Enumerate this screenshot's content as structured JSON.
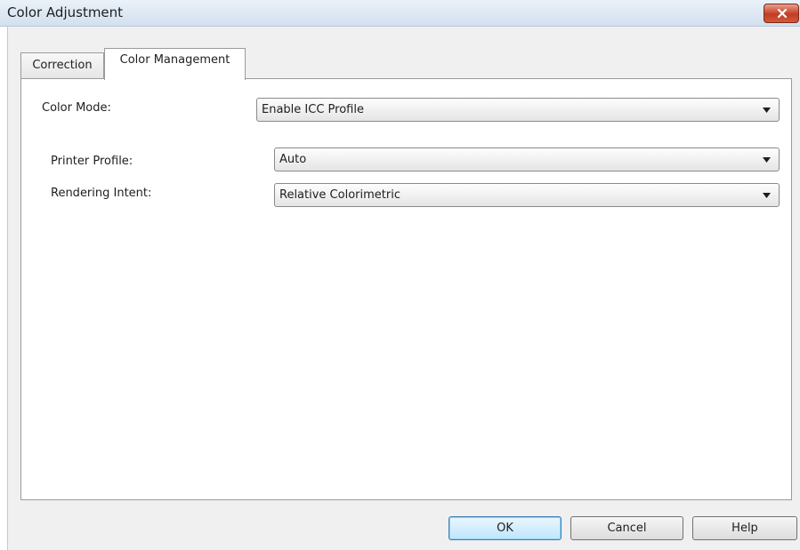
{
  "window": {
    "title": "Color Adjustment"
  },
  "tabs": [
    {
      "label": "Correction",
      "selected": false
    },
    {
      "label": "Color Management",
      "selected": true
    }
  ],
  "color_management": {
    "color_mode": {
      "label": "Color Mode:",
      "value": "Enable ICC Profile"
    },
    "printer_profile": {
      "label": "Printer Profile:",
      "value": "Auto"
    },
    "rendering_intent": {
      "label": "Rendering Intent:",
      "value": "Relative Colorimetric"
    }
  },
  "buttons": {
    "ok": "OK",
    "cancel": "Cancel",
    "help": "Help"
  },
  "icons": {
    "close": "close-icon",
    "dropdown": "chevron-down-icon"
  },
  "colors": {
    "titlebar": "#d2e0ef",
    "close_button": "#c43b22",
    "dialog_background": "#f0f0f0",
    "ok_button_accent": "#3c7fb1"
  }
}
